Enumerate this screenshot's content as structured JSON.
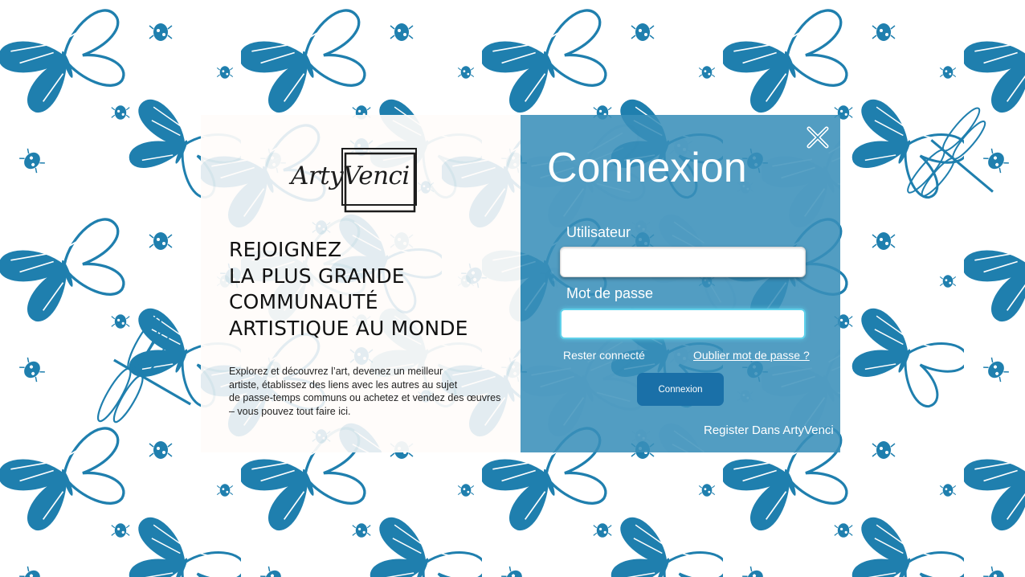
{
  "brand": {
    "logo_text": "ArtyVenci"
  },
  "promo": {
    "headline_lines": [
      "REJOIGNEZ",
      "LA PLUS GRANDE",
      "COMMUNAUTÉ",
      "ARTISTIQUE AU MONDE"
    ],
    "description_lines": [
      "Explorez et découvrez l’art, devenez un meilleur",
      "artiste, établissez des liens avec les autres au sujet",
      "de passe-temps communs ou achetez et vendez des œuvres",
      "– vous pouvez tout faire ici."
    ]
  },
  "login": {
    "title": "Connexion",
    "username_label": "Utilisateur",
    "username_value": "",
    "password_label": "Mot de passe",
    "password_value": "",
    "remember_label": "Rester connecté",
    "forgot_label": "Oublier mot de passe ?",
    "submit_label": "Connexion",
    "register_label": "Register Dans ArtyVenci",
    "close_icon": "close-icon"
  },
  "colors": {
    "pattern": "#1f7fae",
    "panel": "#3a90ba",
    "button": "#1a70a8",
    "field_focus": "#5fd0ea"
  }
}
